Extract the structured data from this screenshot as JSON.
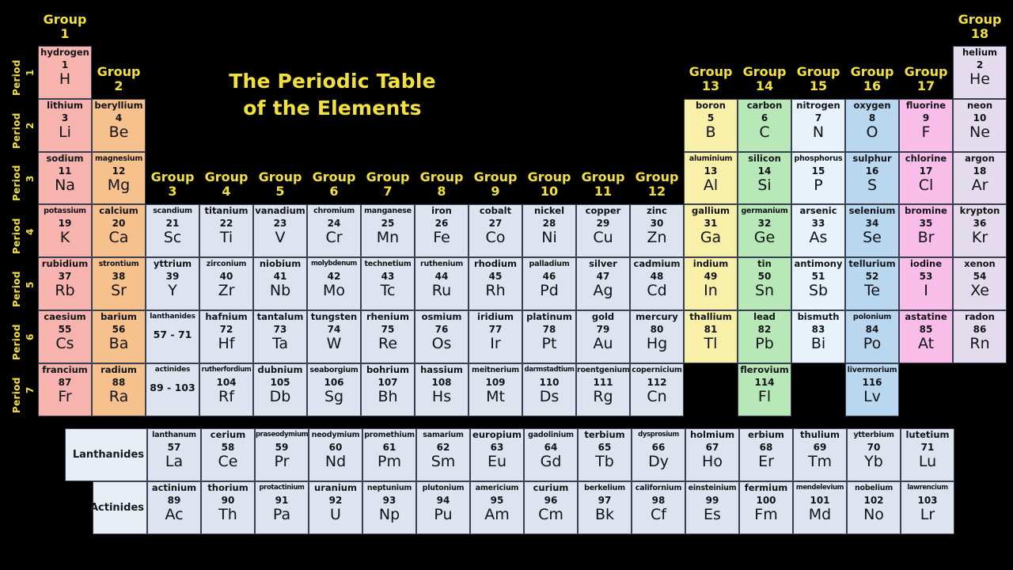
{
  "title": {
    "line1": "The Periodic Table",
    "line2": "of the Elements"
  },
  "colors": {
    "background": "#000000",
    "accent_yellow": "#f2e03c",
    "group1": "#f7b3ae",
    "group2": "#f7c18d",
    "transition": "#dde4ef",
    "group13": "#f8efa8",
    "group14": "#b8e8b8",
    "group15": "#e8f2fa",
    "group16": "#b9d8f0",
    "group17": "#f9bdea",
    "group18": "#e4dcec",
    "series_label": "#e8eef5",
    "cell_border": "#3a3f52"
  },
  "group_headers": [
    {
      "label": "Group",
      "number": "1"
    },
    {
      "label": "Group",
      "number": "2"
    },
    {
      "label": "Group",
      "number": "3"
    },
    {
      "label": "Group",
      "number": "4"
    },
    {
      "label": "Group",
      "number": "5"
    },
    {
      "label": "Group",
      "number": "6"
    },
    {
      "label": "Group",
      "number": "7"
    },
    {
      "label": "Group",
      "number": "8"
    },
    {
      "label": "Group",
      "number": "9"
    },
    {
      "label": "Group",
      "number": "10"
    },
    {
      "label": "Group",
      "number": "11"
    },
    {
      "label": "Group",
      "number": "12"
    },
    {
      "label": "Group",
      "number": "13"
    },
    {
      "label": "Group",
      "number": "14"
    },
    {
      "label": "Group",
      "number": "15"
    },
    {
      "label": "Group",
      "number": "16"
    },
    {
      "label": "Group",
      "number": "17"
    },
    {
      "label": "Group",
      "number": "18"
    }
  ],
  "period_labels": [
    {
      "label": "Period",
      "number": "1"
    },
    {
      "label": "Period",
      "number": "2"
    },
    {
      "label": "Period",
      "number": "3"
    },
    {
      "label": "Period",
      "number": "4"
    },
    {
      "label": "Period",
      "number": "5"
    },
    {
      "label": "Period",
      "number": "6"
    },
    {
      "label": "Period",
      "number": "7"
    }
  ],
  "series_labels": [
    {
      "text": "Lanthanides"
    },
    {
      "text": "Actinides"
    }
  ],
  "elements": [
    {
      "name": "hydrogen",
      "number": "1",
      "symbol": "H",
      "group": 1,
      "period": 1,
      "cat": "group1"
    },
    {
      "name": "helium",
      "number": "2",
      "symbol": "He",
      "group": 18,
      "period": 1,
      "cat": "group18"
    },
    {
      "name": "lithium",
      "number": "3",
      "symbol": "Li",
      "group": 1,
      "period": 2,
      "cat": "group1"
    },
    {
      "name": "beryllium",
      "number": "4",
      "symbol": "Be",
      "group": 2,
      "period": 2,
      "cat": "group2"
    },
    {
      "name": "boron",
      "number": "5",
      "symbol": "B",
      "group": 13,
      "period": 2,
      "cat": "group13"
    },
    {
      "name": "carbon",
      "number": "6",
      "symbol": "C",
      "group": 14,
      "period": 2,
      "cat": "group14"
    },
    {
      "name": "nitrogen",
      "number": "7",
      "symbol": "N",
      "group": 15,
      "period": 2,
      "cat": "group15"
    },
    {
      "name": "oxygen",
      "number": "8",
      "symbol": "O",
      "group": 16,
      "period": 2,
      "cat": "group16"
    },
    {
      "name": "fluorine",
      "number": "9",
      "symbol": "F",
      "group": 17,
      "period": 2,
      "cat": "group17"
    },
    {
      "name": "neon",
      "number": "10",
      "symbol": "Ne",
      "group": 18,
      "period": 2,
      "cat": "group18"
    },
    {
      "name": "sodium",
      "number": "11",
      "symbol": "Na",
      "group": 1,
      "period": 3,
      "cat": "group1"
    },
    {
      "name": "magnesium",
      "number": "12",
      "symbol": "Mg",
      "group": 2,
      "period": 3,
      "cat": "group2",
      "sq": 1
    },
    {
      "name": "aluminium",
      "number": "13",
      "symbol": "Al",
      "group": 13,
      "period": 3,
      "cat": "group13",
      "sq": 1
    },
    {
      "name": "silicon",
      "number": "14",
      "symbol": "Si",
      "group": 14,
      "period": 3,
      "cat": "group14"
    },
    {
      "name": "phosphorus",
      "number": "15",
      "symbol": "P",
      "group": 15,
      "period": 3,
      "cat": "group15",
      "sq": 1
    },
    {
      "name": "sulphur",
      "number": "16",
      "symbol": "S",
      "group": 16,
      "period": 3,
      "cat": "group16"
    },
    {
      "name": "chlorine",
      "number": "17",
      "symbol": "Cl",
      "group": 17,
      "period": 3,
      "cat": "group17"
    },
    {
      "name": "argon",
      "number": "18",
      "symbol": "Ar",
      "group": 18,
      "period": 3,
      "cat": "group18"
    },
    {
      "name": "potassium",
      "number": "19",
      "symbol": "K",
      "group": 1,
      "period": 4,
      "cat": "group1",
      "sq": 1
    },
    {
      "name": "calcium",
      "number": "20",
      "symbol": "Ca",
      "group": 2,
      "period": 4,
      "cat": "group2"
    },
    {
      "name": "scandium",
      "number": "21",
      "symbol": "Sc",
      "group": 3,
      "period": 4,
      "cat": "transition",
      "sq": 1
    },
    {
      "name": "titanium",
      "number": "22",
      "symbol": "Ti",
      "group": 4,
      "period": 4,
      "cat": "transition"
    },
    {
      "name": "vanadium",
      "number": "23",
      "symbol": "V",
      "group": 5,
      "period": 4,
      "cat": "transition"
    },
    {
      "name": "chromium",
      "number": "24",
      "symbol": "Cr",
      "group": 6,
      "period": 4,
      "cat": "transition",
      "sq": 1
    },
    {
      "name": "manganese",
      "number": "25",
      "symbol": "Mn",
      "group": 7,
      "period": 4,
      "cat": "transition",
      "sq": 1
    },
    {
      "name": "iron",
      "number": "26",
      "symbol": "Fe",
      "group": 8,
      "period": 4,
      "cat": "transition"
    },
    {
      "name": "cobalt",
      "number": "27",
      "symbol": "Co",
      "group": 9,
      "period": 4,
      "cat": "transition"
    },
    {
      "name": "nickel",
      "number": "28",
      "symbol": "Ni",
      "group": 10,
      "period": 4,
      "cat": "transition"
    },
    {
      "name": "copper",
      "number": "29",
      "symbol": "Cu",
      "group": 11,
      "period": 4,
      "cat": "transition"
    },
    {
      "name": "zinc",
      "number": "30",
      "symbol": "Zn",
      "group": 12,
      "period": 4,
      "cat": "transition"
    },
    {
      "name": "gallium",
      "number": "31",
      "symbol": "Ga",
      "group": 13,
      "period": 4,
      "cat": "group13"
    },
    {
      "name": "germanium",
      "number": "32",
      "symbol": "Ge",
      "group": 14,
      "period": 4,
      "cat": "group14",
      "sq": 1
    },
    {
      "name": "arsenic",
      "number": "33",
      "symbol": "As",
      "group": 15,
      "period": 4,
      "cat": "group15"
    },
    {
      "name": "selenium",
      "number": "34",
      "symbol": "Se",
      "group": 16,
      "period": 4,
      "cat": "group16"
    },
    {
      "name": "bromine",
      "number": "35",
      "symbol": "Br",
      "group": 17,
      "period": 4,
      "cat": "group17"
    },
    {
      "name": "krypton",
      "number": "36",
      "symbol": "Kr",
      "group": 18,
      "period": 4,
      "cat": "group18"
    },
    {
      "name": "rubidium",
      "number": "37",
      "symbol": "Rb",
      "group": 1,
      "period": 5,
      "cat": "group1"
    },
    {
      "name": "strontium",
      "number": "38",
      "symbol": "Sr",
      "group": 2,
      "period": 5,
      "cat": "group2",
      "sq": 1
    },
    {
      "name": "yttrium",
      "number": "39",
      "symbol": "Y",
      "group": 3,
      "period": 5,
      "cat": "transition"
    },
    {
      "name": "zirconium",
      "number": "40",
      "symbol": "Zr",
      "group": 4,
      "period": 5,
      "cat": "transition",
      "sq": 1
    },
    {
      "name": "niobium",
      "number": "41",
      "symbol": "Nb",
      "group": 5,
      "period": 5,
      "cat": "transition"
    },
    {
      "name": "molybdenum",
      "number": "42",
      "symbol": "Mo",
      "group": 6,
      "period": 5,
      "cat": "transition",
      "sq": 2
    },
    {
      "name": "technetium",
      "number": "43",
      "symbol": "Tc",
      "group": 7,
      "period": 5,
      "cat": "transition",
      "sq": 1
    },
    {
      "name": "ruthenium",
      "number": "44",
      "symbol": "Ru",
      "group": 8,
      "period": 5,
      "cat": "transition",
      "sq": 1
    },
    {
      "name": "rhodium",
      "number": "45",
      "symbol": "Rh",
      "group": 9,
      "period": 5,
      "cat": "transition"
    },
    {
      "name": "palladium",
      "number": "46",
      "symbol": "Pd",
      "group": 10,
      "period": 5,
      "cat": "transition",
      "sq": 1
    },
    {
      "name": "silver",
      "number": "47",
      "symbol": "Ag",
      "group": 11,
      "period": 5,
      "cat": "transition"
    },
    {
      "name": "cadmium",
      "number": "48",
      "symbol": "Cd",
      "group": 12,
      "period": 5,
      "cat": "transition"
    },
    {
      "name": "indium",
      "number": "49",
      "symbol": "In",
      "group": 13,
      "period": 5,
      "cat": "group13"
    },
    {
      "name": "tin",
      "number": "50",
      "symbol": "Sn",
      "group": 14,
      "period": 5,
      "cat": "group14"
    },
    {
      "name": "antimony",
      "number": "51",
      "symbol": "Sb",
      "group": 15,
      "period": 5,
      "cat": "group15"
    },
    {
      "name": "tellurium",
      "number": "52",
      "symbol": "Te",
      "group": 16,
      "period": 5,
      "cat": "group16"
    },
    {
      "name": "iodine",
      "number": "53",
      "symbol": "I",
      "group": 17,
      "period": 5,
      "cat": "group17"
    },
    {
      "name": "xenon",
      "number": "54",
      "symbol": "Xe",
      "group": 18,
      "period": 5,
      "cat": "group18"
    },
    {
      "name": "caesium",
      "number": "55",
      "symbol": "Cs",
      "group": 1,
      "period": 6,
      "cat": "group1"
    },
    {
      "name": "barium",
      "number": "56",
      "symbol": "Ba",
      "group": 2,
      "period": 6,
      "cat": "group2"
    },
    {
      "name": "hafnium",
      "number": "72",
      "symbol": "Hf",
      "group": 4,
      "period": 6,
      "cat": "transition"
    },
    {
      "name": "tantalum",
      "number": "73",
      "symbol": "Ta",
      "group": 5,
      "period": 6,
      "cat": "transition"
    },
    {
      "name": "tungsten",
      "number": "74",
      "symbol": "W",
      "group": 6,
      "period": 6,
      "cat": "transition"
    },
    {
      "name": "rhenium",
      "number": "75",
      "symbol": "Re",
      "group": 7,
      "period": 6,
      "cat": "transition"
    },
    {
      "name": "osmium",
      "number": "76",
      "symbol": "Os",
      "group": 8,
      "period": 6,
      "cat": "transition"
    },
    {
      "name": "iridium",
      "number": "77",
      "symbol": "Ir",
      "group": 9,
      "period": 6,
      "cat": "transition"
    },
    {
      "name": "platinum",
      "number": "78",
      "symbol": "Pt",
      "group": 10,
      "period": 6,
      "cat": "transition"
    },
    {
      "name": "gold",
      "number": "79",
      "symbol": "Au",
      "group": 11,
      "period": 6,
      "cat": "transition"
    },
    {
      "name": "mercury",
      "number": "80",
      "symbol": "Hg",
      "group": 12,
      "period": 6,
      "cat": "transition"
    },
    {
      "name": "thallium",
      "number": "81",
      "symbol": "Tl",
      "group": 13,
      "period": 6,
      "cat": "group13"
    },
    {
      "name": "lead",
      "number": "82",
      "symbol": "Pb",
      "group": 14,
      "period": 6,
      "cat": "group14"
    },
    {
      "name": "bismuth",
      "number": "83",
      "symbol": "Bi",
      "group": 15,
      "period": 6,
      "cat": "group15"
    },
    {
      "name": "polonium",
      "number": "84",
      "symbol": "Po",
      "group": 16,
      "period": 6,
      "cat": "group16",
      "sq": 1
    },
    {
      "name": "astatine",
      "number": "85",
      "symbol": "At",
      "group": 17,
      "period": 6,
      "cat": "group17"
    },
    {
      "name": "radon",
      "number": "86",
      "symbol": "Rn",
      "group": 18,
      "period": 6,
      "cat": "group18"
    },
    {
      "name": "francium",
      "number": "87",
      "symbol": "Fr",
      "group": 1,
      "period": 7,
      "cat": "group1"
    },
    {
      "name": "radium",
      "number": "88",
      "symbol": "Ra",
      "group": 2,
      "period": 7,
      "cat": "group2"
    },
    {
      "name": "rutherfordium",
      "number": "104",
      "symbol": "Rf",
      "group": 4,
      "period": 7,
      "cat": "transition",
      "sq": 2
    },
    {
      "name": "dubnium",
      "number": "105",
      "symbol": "Db",
      "group": 5,
      "period": 7,
      "cat": "transition"
    },
    {
      "name": "seaborgium",
      "number": "106",
      "symbol": "Sg",
      "group": 6,
      "period": 7,
      "cat": "transition",
      "sq": 1
    },
    {
      "name": "bohrium",
      "number": "107",
      "symbol": "Bh",
      "group": 7,
      "period": 7,
      "cat": "transition"
    },
    {
      "name": "hassium",
      "number": "108",
      "symbol": "Hs",
      "group": 8,
      "period": 7,
      "cat": "transition"
    },
    {
      "name": "meitnerium",
      "number": "109",
      "symbol": "Mt",
      "group": 9,
      "period": 7,
      "cat": "transition",
      "sq": 1
    },
    {
      "name": "darmstadtium",
      "number": "110",
      "symbol": "Ds",
      "group": 10,
      "period": 7,
      "cat": "transition",
      "sq": 2
    },
    {
      "name": "roentgenium",
      "number": "111",
      "symbol": "Rg",
      "group": 11,
      "period": 7,
      "cat": "transition",
      "sq": 1
    },
    {
      "name": "copernicium",
      "number": "112",
      "symbol": "Cn",
      "group": 12,
      "period": 7,
      "cat": "transition",
      "sq": 1
    },
    {
      "name": "flerovium",
      "number": "114",
      "symbol": "Fl",
      "group": 14,
      "period": 7,
      "cat": "group14"
    },
    {
      "name": "livermorium",
      "number": "116",
      "symbol": "Lv",
      "group": 16,
      "period": 7,
      "cat": "group16",
      "sq": 1
    }
  ],
  "placeholders": [
    {
      "name": "lanthanides",
      "range": "57 - 71",
      "group": 3,
      "period": 6,
      "cat": "transition"
    },
    {
      "name": "actinides",
      "range": "89 - 103",
      "group": 3,
      "period": 7,
      "cat": "transition"
    }
  ],
  "lanthanides": [
    {
      "name": "lanthanum",
      "number": "57",
      "symbol": "La",
      "sq": 1
    },
    {
      "name": "cerium",
      "number": "58",
      "symbol": "Ce"
    },
    {
      "name": "praseodymium",
      "number": "59",
      "symbol": "Pr",
      "sq": 2
    },
    {
      "name": "neodymium",
      "number": "60",
      "symbol": "Nd",
      "sq": 1
    },
    {
      "name": "promethium",
      "number": "61",
      "symbol": "Pm",
      "sq": 1
    },
    {
      "name": "samarium",
      "number": "62",
      "symbol": "Sm",
      "sq": 1
    },
    {
      "name": "europium",
      "number": "63",
      "symbol": "Eu"
    },
    {
      "name": "gadolinium",
      "number": "64",
      "symbol": "Gd",
      "sq": 1
    },
    {
      "name": "terbium",
      "number": "65",
      "symbol": "Tb"
    },
    {
      "name": "dysprosium",
      "number": "66",
      "symbol": "Dy",
      "sq": 2
    },
    {
      "name": "holmium",
      "number": "67",
      "symbol": "Ho"
    },
    {
      "name": "erbium",
      "number": "68",
      "symbol": "Er"
    },
    {
      "name": "thulium",
      "number": "69",
      "symbol": "Tm"
    },
    {
      "name": "ytterbium",
      "number": "70",
      "symbol": "Yb",
      "sq": 1
    },
    {
      "name": "lutetium",
      "number": "71",
      "symbol": "Lu"
    }
  ],
  "actinides": [
    {
      "name": "actinium",
      "number": "89",
      "symbol": "Ac"
    },
    {
      "name": "thorium",
      "number": "90",
      "symbol": "Th"
    },
    {
      "name": "protactinium",
      "number": "91",
      "symbol": "Pa",
      "sq": 2
    },
    {
      "name": "uranium",
      "number": "92",
      "symbol": "U"
    },
    {
      "name": "neptunium",
      "number": "93",
      "symbol": "Np",
      "sq": 1
    },
    {
      "name": "plutonium",
      "number": "94",
      "symbol": "Pu",
      "sq": 1
    },
    {
      "name": "americium",
      "number": "95",
      "symbol": "Am",
      "sq": 1
    },
    {
      "name": "curium",
      "number": "96",
      "symbol": "Cm"
    },
    {
      "name": "berkelium",
      "number": "97",
      "symbol": "Bk",
      "sq": 1
    },
    {
      "name": "californium",
      "number": "98",
      "symbol": "Cf",
      "sq": 1
    },
    {
      "name": "einsteinium",
      "number": "99",
      "symbol": "Es",
      "sq": 1
    },
    {
      "name": "fermium",
      "number": "100",
      "symbol": "Fm"
    },
    {
      "name": "mendelevium",
      "number": "101",
      "symbol": "Md",
      "sq": 2
    },
    {
      "name": "nobelium",
      "number": "102",
      "symbol": "No",
      "sq": 1
    },
    {
      "name": "lawrencium",
      "number": "103",
      "symbol": "Lr",
      "sq": 2
    }
  ]
}
